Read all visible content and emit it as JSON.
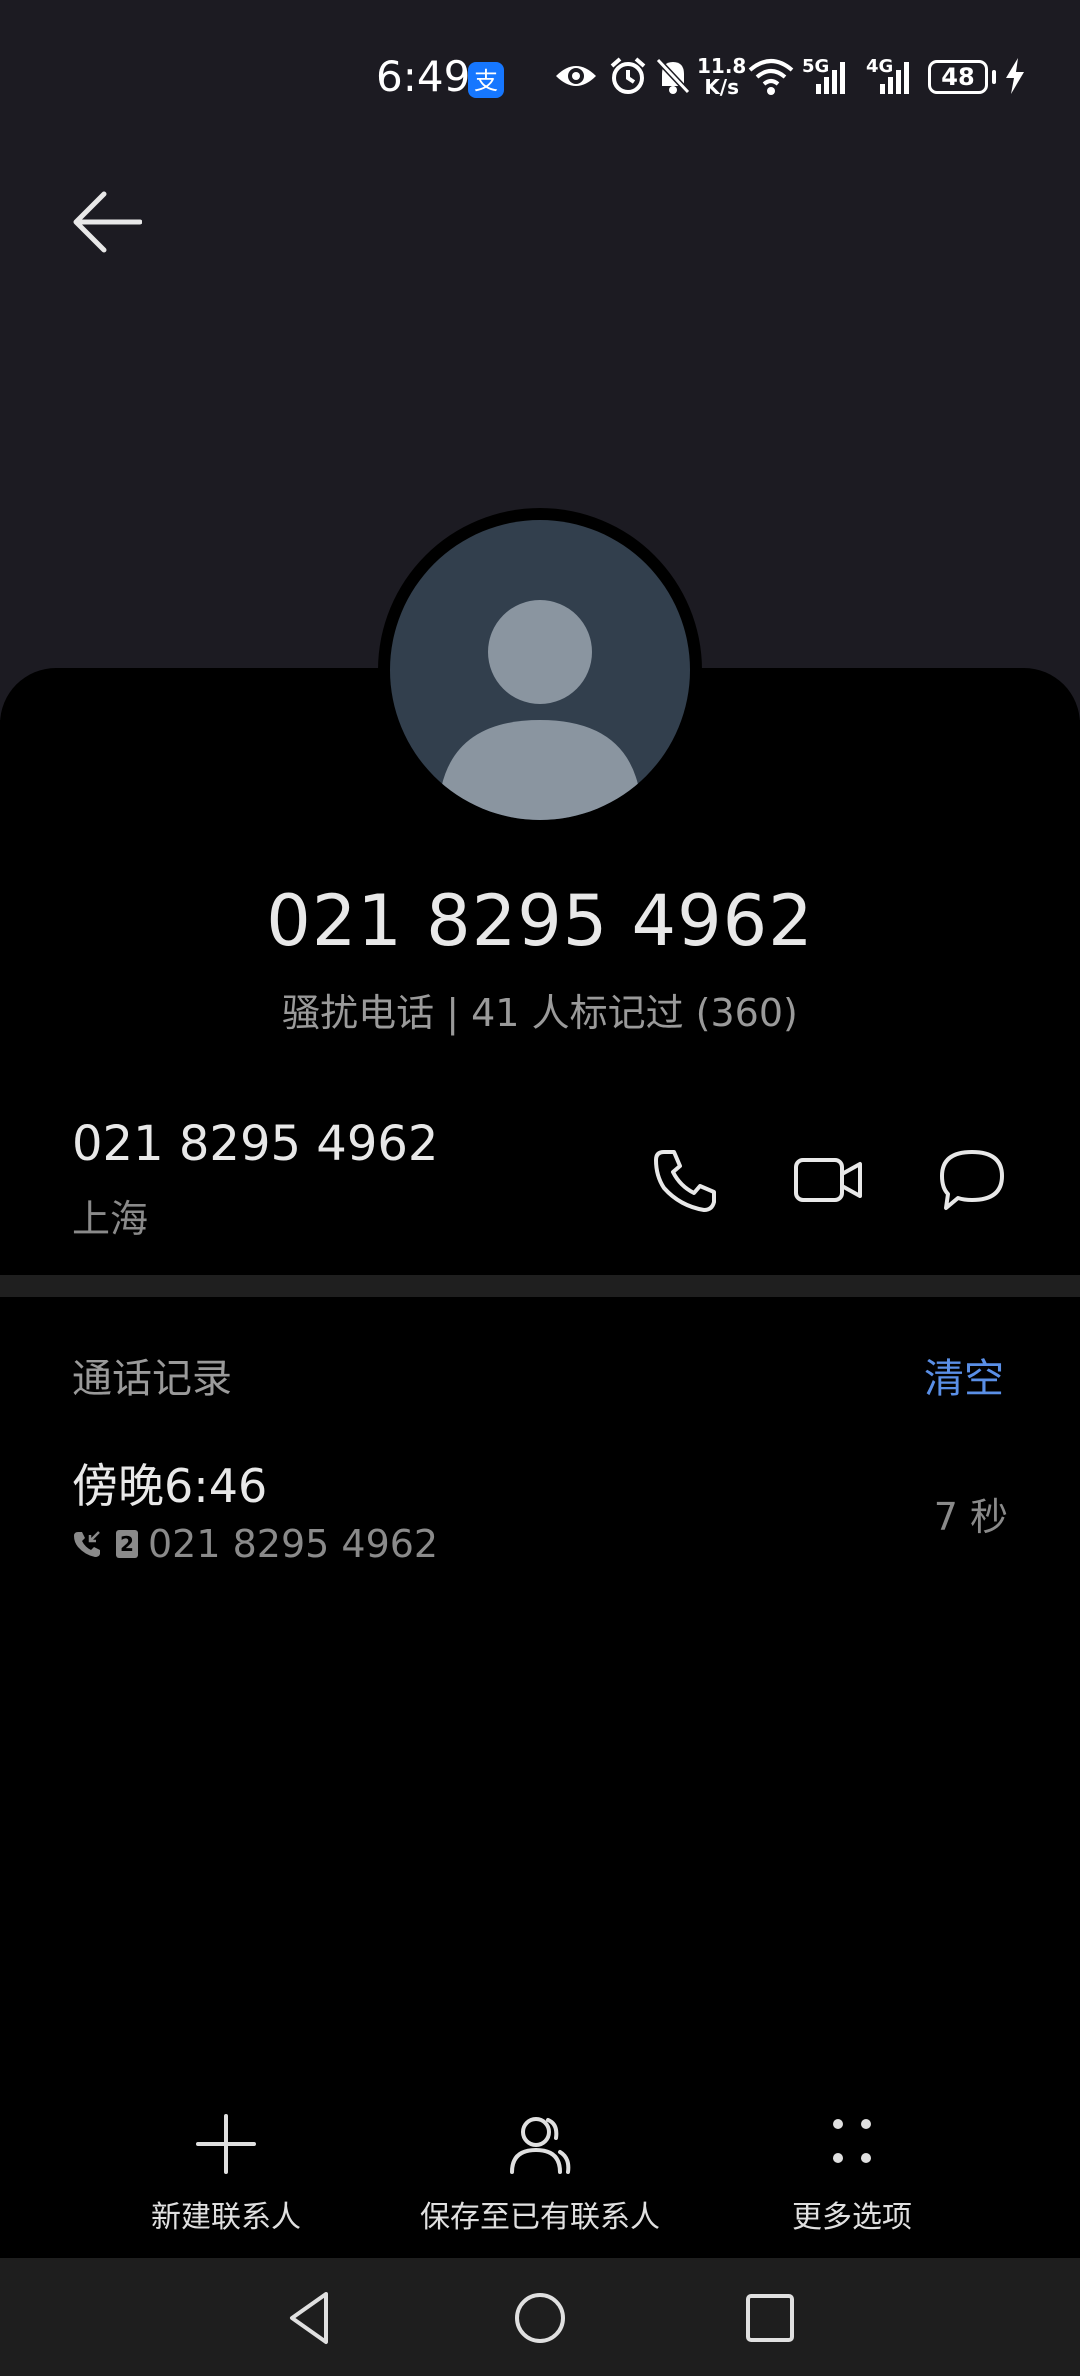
{
  "status_bar": {
    "time": "6:49",
    "network_speed_value": "11.8",
    "network_speed_unit": "K/s",
    "battery_level": "48",
    "signal_1": "5G",
    "signal_2": "4G",
    "icons": [
      "alipay-icon",
      "eye-icon",
      "alarm-icon",
      "bell-muted-icon",
      "wifi-icon",
      "signal-icon",
      "battery-icon",
      "charging-icon"
    ]
  },
  "contact": {
    "number_display": "021 8295 4962",
    "tag_line": "骚扰电话 | 41 人标记过 (360)",
    "row_number": "021 8295 4962",
    "location": "上海"
  },
  "call_log": {
    "title": "通话记录",
    "clear_label": "清空",
    "entries": [
      {
        "time": "傍晚6:46",
        "sim": "2",
        "number": "021 8295 4962",
        "duration": "7 秒"
      }
    ]
  },
  "bottom_actions": {
    "new_contact": "新建联系人",
    "save_existing": "保存至已有联系人",
    "more_options": "更多选项"
  },
  "colors": {
    "accent": "#5a8fe6",
    "header_bg": "#1c1b22",
    "sheet_bg": "#000000",
    "avatar_bg": "#323f4d"
  }
}
